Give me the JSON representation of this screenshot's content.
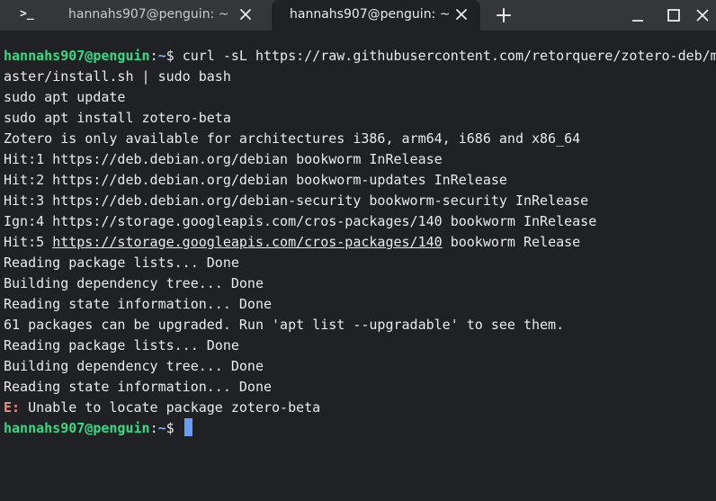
{
  "window": {
    "app_icon_text": ">_",
    "tabs": [
      {
        "label": "hannahs907@penguin: ~",
        "active": false
      },
      {
        "label": "hannahs907@penguin: ~",
        "active": true
      }
    ],
    "icons": {
      "tab_close": "close-icon",
      "new_tab": "plus-icon",
      "minimize": "minimize-icon",
      "maximize": "maximize-icon",
      "close": "close-icon"
    }
  },
  "terminal": {
    "colors": {
      "background": "#202124",
      "prompt_user": "#38d985",
      "prompt_path": "#8ab4f8",
      "error": "#f28b82",
      "cursor": "#669df6"
    },
    "prompt_user": "hannahs907@penguin",
    "prompt_sep": ":",
    "prompt_path": "~",
    "prompt_end": "$ ",
    "command_line_1": "curl -sL https://raw.githubusercontent.com/retorquere/zotero-deb/m",
    "command_line_2": "aster/install.sh | sudo bash",
    "output": [
      "sudo apt update",
      "sudo apt install zotero-beta",
      "Zotero is only available for architectures i386, arm64, i686 and x86_64",
      "Hit:1 https://deb.debian.org/debian bookworm InRelease",
      "Hit:2 https://deb.debian.org/debian bookworm-updates InRelease",
      "Hit:3 https://deb.debian.org/debian-security bookworm-security InRelease",
      "Ign:4 https://storage.googleapis.com/cros-packages/140 bookworm InRelease"
    ],
    "hit5": {
      "prefix": "Hit:5 ",
      "url": "https://storage.googleapis.com/cros-packages/140",
      "suffix": " bookworm Release"
    },
    "output2": [
      "Reading package lists... Done",
      "Building dependency tree... Done",
      "Reading state information... Done",
      "61 packages can be upgraded. Run 'apt list --upgradable' to see them.",
      "Reading package lists... Done",
      "Building dependency tree... Done",
      "Reading state information... Done"
    ],
    "error": {
      "prefix": "E:",
      "message": " Unable to locate package zotero-beta"
    }
  }
}
